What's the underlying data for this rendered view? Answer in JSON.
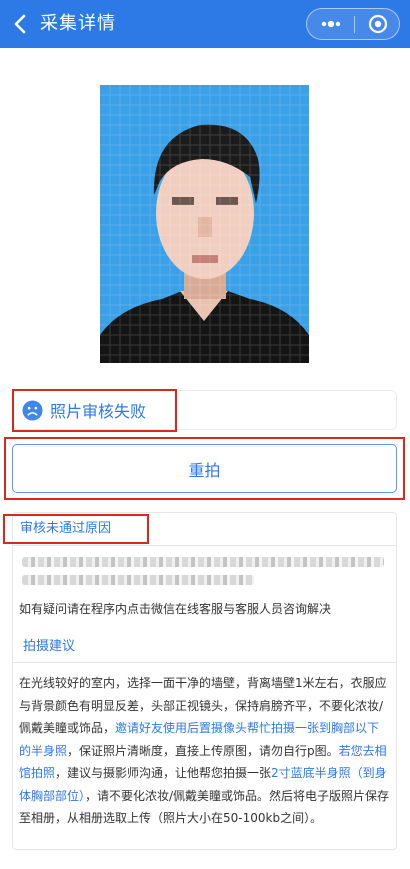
{
  "navbar": {
    "title": "采集详情",
    "bg_color": "#2d79e6"
  },
  "status": {
    "text": "照片审核失败",
    "color": "#2d79e6",
    "highlight_color": "#d9281e"
  },
  "retake": {
    "label": "重拍"
  },
  "reason": {
    "title": "审核未通过原因",
    "contact_text": "如有疑问请在程序内点击微信在线客服与客服人员咨询解决"
  },
  "tips": {
    "title": "拍摄建议",
    "p1": "在光线较好的室内，选择一面干净的墙壁，背离墙壁1米左右，衣服应与背景颜色有明显反差，头部正视镜头，保持肩膀齐平，不要化浓妆/佩戴美瞳或饰品，",
    "h1": "邀请好友使用后置摄像头帮忙拍摄一张到胸部以下的半身照",
    "p2": "，保证照片清晰度，直接上传原图，请勿自行p图。",
    "h2": "若您去相馆拍照",
    "p3": "，建议与摄影师沟通，让他帮您拍摄一张",
    "h3": "2寸蓝底半身照（到身体胸部部位）",
    "p4": "，请不要化浓妆/佩戴美瞳或饰品。然后将电子版照片保存至相册，从相册选取上传（照片大小在50-100kb之间）。"
  },
  "icons": {
    "back": "chevron-left-icon",
    "more": "more-dots-icon",
    "close": "target-icon",
    "sad": "sad-face-icon"
  }
}
